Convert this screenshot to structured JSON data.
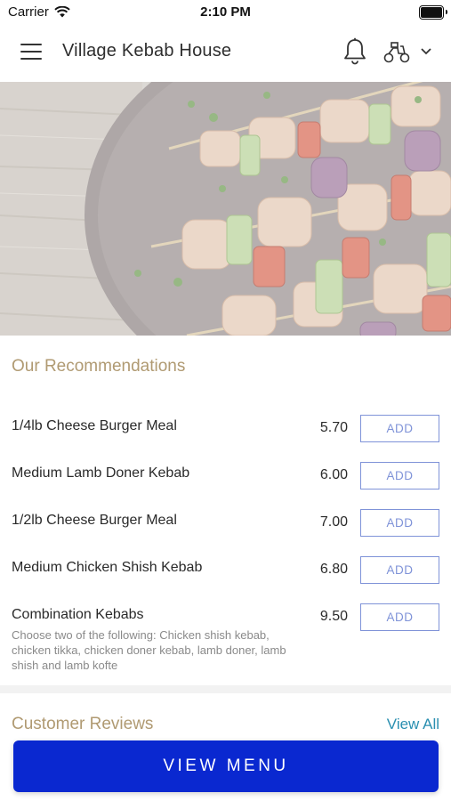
{
  "status_bar": {
    "carrier": "Carrier",
    "time": "2:10 PM"
  },
  "header": {
    "title": "Village Kebab House",
    "icons": [
      "menu-icon",
      "bell-icon",
      "scooter-icon",
      "chevron-down-icon"
    ]
  },
  "hero": {
    "image_subject": "chicken and vegetable kebab skewers on a plate over wooden table"
  },
  "recommendations": {
    "title": "Our Recommendations",
    "items": [
      {
        "name": "1/4lb Cheese Burger Meal",
        "price": "5.70",
        "button": "ADD",
        "description": ""
      },
      {
        "name": "Medium Lamb Doner Kebab",
        "price": "6.00",
        "button": "ADD",
        "description": ""
      },
      {
        "name": "1/2lb Cheese Burger Meal",
        "price": "7.00",
        "button": "ADD",
        "description": ""
      },
      {
        "name": "Medium Chicken Shish Kebab",
        "price": "6.80",
        "button": "ADD",
        "description": ""
      },
      {
        "name": "Combination Kebabs",
        "price": "9.50",
        "button": "ADD",
        "description": "Choose two of the following: Chicken shish kebab, chicken tikka, chicken doner kebab, lamb doner, lamb shish and lamb kofte"
      }
    ]
  },
  "reviews": {
    "title": "Customer Reviews",
    "view_all": "View All"
  },
  "cta": {
    "label": "VIEW MENU"
  },
  "colors": {
    "accent_gold": "#b09a72",
    "add_button": "#7f93d8",
    "link": "#2a8fb0",
    "cta_background": "#0a28d0"
  }
}
